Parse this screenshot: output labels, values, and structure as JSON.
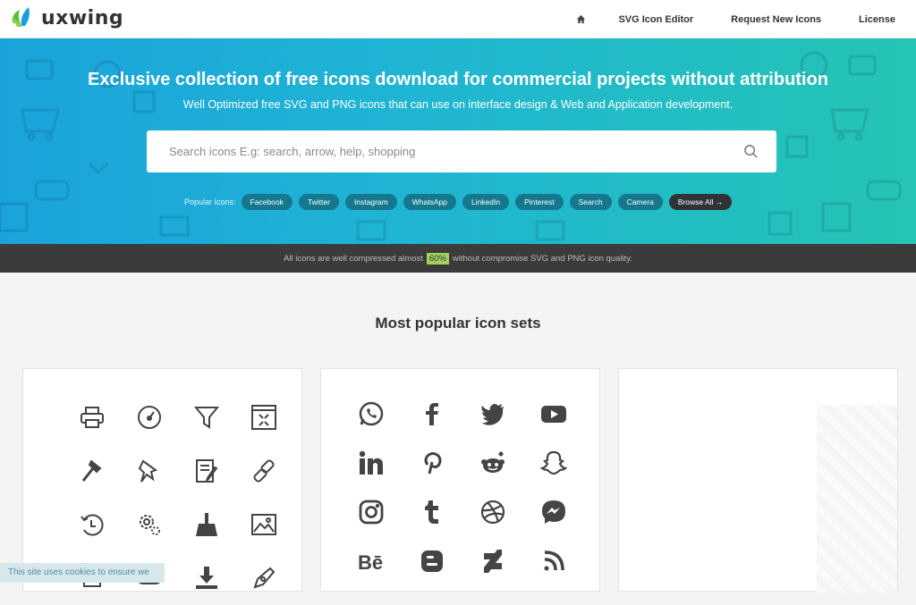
{
  "brand": {
    "logo_text": "uxwing",
    "accent": "#21b5d0"
  },
  "nav": {
    "home_icon": "home-icon",
    "items": [
      "SVG Icon Editor",
      "Request New Icons",
      "License"
    ]
  },
  "hero": {
    "title": "Exclusive collection of free icons download for commercial projects without attribution",
    "subtitle": "Well Optimized free SVG and PNG icons that can use on interface design & Web and Application development.",
    "search_placeholder": "Search icons E.g: search, arrow, help, shopping",
    "popular_label": "Popular Icons:",
    "chips": [
      "Facebook",
      "Twitter",
      "Instagram",
      "WhatsApp",
      "LinkedIn",
      "Pinterest",
      "Search",
      "Camera",
      "Browse All →"
    ]
  },
  "strip": {
    "before": "All icons are well compressed almost",
    "badge": "60%",
    "after": "without compromise SVG and PNG icon quality."
  },
  "section": {
    "title": "Most popular icon sets"
  },
  "card1_icons": [
    "printer-icon",
    "speedometer-icon",
    "filter-icon",
    "collapse-window-icon",
    "hammer-icon",
    "pin-icon",
    "edit-document-icon",
    "link-icon",
    "history-icon",
    "settings-icon",
    "broom-icon",
    "image-icon",
    "trash-icon",
    "toggle-icon",
    "download-icon",
    "pen-tool-icon"
  ],
  "card2_icons": [
    "whatsapp-icon",
    "facebook-icon",
    "twitter-icon",
    "youtube-icon",
    "linkedin-icon",
    "pinterest-icon",
    "reddit-icon",
    "snapchat-icon",
    "instagram-icon",
    "tumblr-icon",
    "dribbble-icon",
    "messenger-icon",
    "behance-icon",
    "blogger-icon",
    "deviantart-icon",
    "rss-icon"
  ],
  "cookie": {
    "text": "This site uses cookies to ensure we"
  }
}
